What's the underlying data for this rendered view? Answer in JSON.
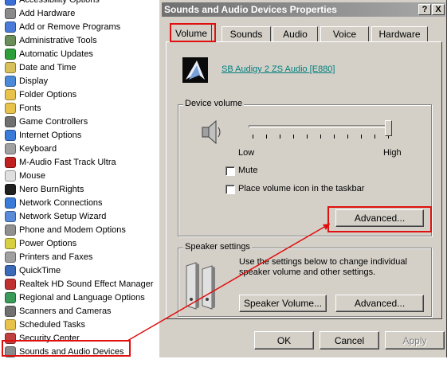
{
  "control_panel": {
    "items": [
      {
        "label": "Accessibility Options",
        "icon": "accessibility-icon",
        "color": "#3b6fd8"
      },
      {
        "label": "Add Hardware",
        "icon": "add-hardware-icon",
        "color": "#8a8a8a"
      },
      {
        "label": "Add or Remove Programs",
        "icon": "add-remove-programs-icon",
        "color": "#4a7bd8"
      },
      {
        "label": "Administrative Tools",
        "icon": "administrative-tools-icon",
        "color": "#6b8e5a"
      },
      {
        "label": "Automatic Updates",
        "icon": "automatic-updates-icon",
        "color": "#2e9e3a"
      },
      {
        "label": "Date and Time",
        "icon": "date-time-icon",
        "color": "#d8c05a"
      },
      {
        "label": "Display",
        "icon": "display-icon",
        "color": "#4a8ad8"
      },
      {
        "label": "Folder Options",
        "icon": "folder-options-icon",
        "color": "#e8c24a"
      },
      {
        "label": "Fonts",
        "icon": "fonts-icon",
        "color": "#e8c24a"
      },
      {
        "label": "Game Controllers",
        "icon": "game-controllers-icon",
        "color": "#707070"
      },
      {
        "label": "Internet Options",
        "icon": "internet-options-icon",
        "color": "#3a7ad8"
      },
      {
        "label": "Keyboard",
        "icon": "keyboard-icon",
        "color": "#a0a0a0"
      },
      {
        "label": "M-Audio Fast Track Ultra",
        "icon": "m-audio-icon",
        "color": "#c02020"
      },
      {
        "label": "Mouse",
        "icon": "mouse-icon",
        "color": "#e0e0e0"
      },
      {
        "label": "Nero BurnRights",
        "icon": "nero-icon",
        "color": "#202020"
      },
      {
        "label": "Network Connections",
        "icon": "network-connections-icon",
        "color": "#3a7ad8"
      },
      {
        "label": "Network Setup Wizard",
        "icon": "network-setup-icon",
        "color": "#5a8ad8"
      },
      {
        "label": "Phone and Modem Options",
        "icon": "phone-modem-icon",
        "color": "#909090"
      },
      {
        "label": "Power Options",
        "icon": "power-options-icon",
        "color": "#d8d040"
      },
      {
        "label": "Printers and Faxes",
        "icon": "printers-faxes-icon",
        "color": "#a0a0a0"
      },
      {
        "label": "QuickTime",
        "icon": "quicktime-icon",
        "color": "#3a6ab8"
      },
      {
        "label": "Realtek HD Sound Effect Manager",
        "icon": "realtek-icon",
        "color": "#c03030"
      },
      {
        "label": "Regional and Language Options",
        "icon": "regional-language-icon",
        "color": "#3a9a5a"
      },
      {
        "label": "Scanners and Cameras",
        "icon": "scanners-cameras-icon",
        "color": "#707070"
      },
      {
        "label": "Scheduled Tasks",
        "icon": "scheduled-tasks-icon",
        "color": "#e8c24a"
      },
      {
        "label": "Security Center",
        "icon": "security-center-icon",
        "color": "#c04040"
      },
      {
        "label": "Sounds and Audio Devices",
        "icon": "sounds-audio-icon",
        "color": "#8a8a8a"
      }
    ]
  },
  "dialog": {
    "title": "Sounds and Audio Devices Properties",
    "help_label": "?",
    "close_label": "X",
    "tabs": [
      "Volume",
      "Sounds",
      "Audio",
      "Voice",
      "Hardware"
    ],
    "device_name": "SB Audigy 2 ZS Audio [E880]",
    "device_volume": {
      "title": "Device volume",
      "low_label": "Low",
      "high_label": "High",
      "level": 0.97,
      "mute_label": "Mute",
      "mute_checked": false,
      "tray_label": "Place volume icon in the taskbar",
      "tray_checked": false,
      "advanced_label": "Advanced..."
    },
    "speaker_settings": {
      "title": "Speaker settings",
      "description": "Use the settings below to change individual speaker volume and other settings.",
      "speaker_volume_label": "Speaker Volume...",
      "advanced_label": "Advanced..."
    },
    "ok_label": "OK",
    "cancel_label": "Cancel",
    "apply_label": "Apply"
  },
  "colors": {
    "highlight": "#e01010",
    "link": "#00807f",
    "face": "#d4d0c8"
  }
}
